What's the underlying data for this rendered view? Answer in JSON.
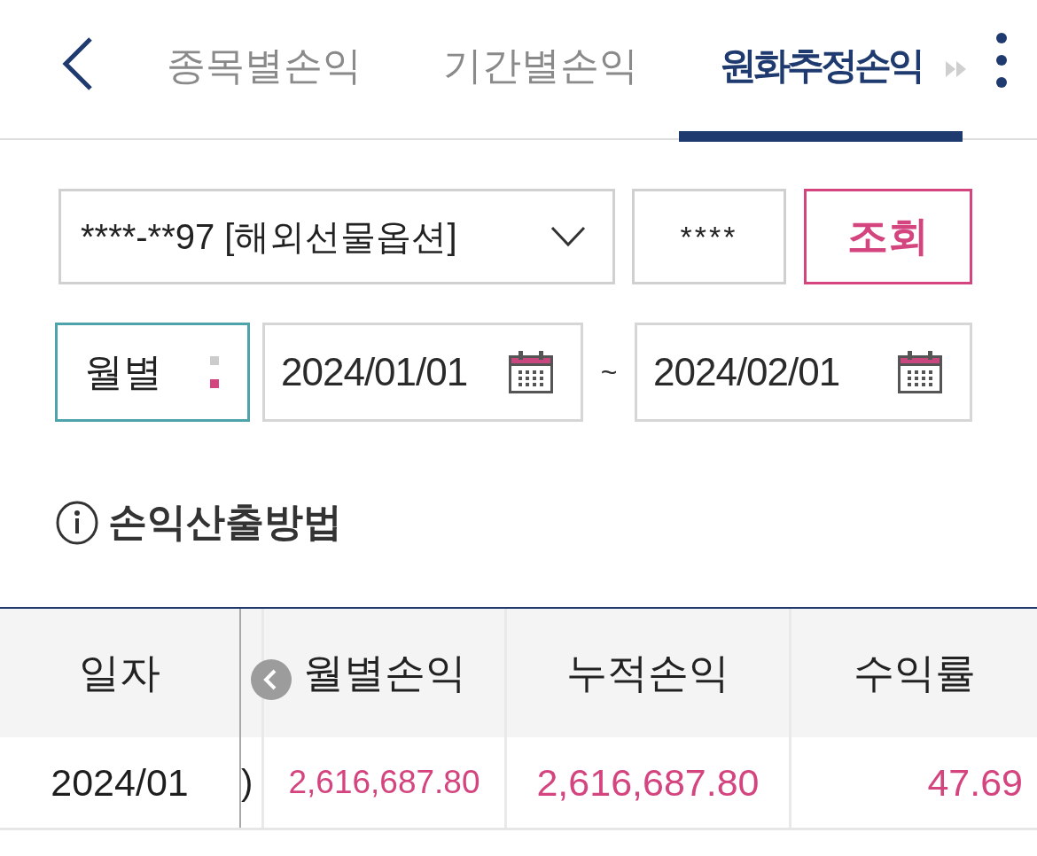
{
  "header": {
    "tabs": [
      {
        "label": "종목별손익",
        "selected": false
      },
      {
        "label": "기간별손익",
        "selected": false
      },
      {
        "label": "원화추정손익",
        "selected": true
      }
    ]
  },
  "query": {
    "account": {
      "value": "****-**97 [해외선물옵션]"
    },
    "password": {
      "value": "****"
    },
    "submit": "조회"
  },
  "period": {
    "unit": "월별",
    "start": "2024/01/01",
    "separator": "~",
    "end": "2024/02/01"
  },
  "info_link": "손익산출방법",
  "table": {
    "columns": [
      {
        "kind": "frozen",
        "label": "일자"
      },
      {
        "kind": "clipped"
      },
      {
        "kind": "scroll",
        "label": "월별손익"
      },
      {
        "kind": "scroll",
        "label": "누적손익"
      },
      {
        "kind": "scroll",
        "label": "수익률"
      }
    ],
    "rows": [
      {
        "cells": [
          {
            "text": "2024/01",
            "positive": false
          },
          {
            "text": ")",
            "positive": false
          },
          {
            "text": "2,616,687.80",
            "positive": true
          },
          {
            "text": "2,616,687.80",
            "positive": true
          },
          {
            "text": "47.69",
            "positive": true
          }
        ]
      }
    ]
  }
}
